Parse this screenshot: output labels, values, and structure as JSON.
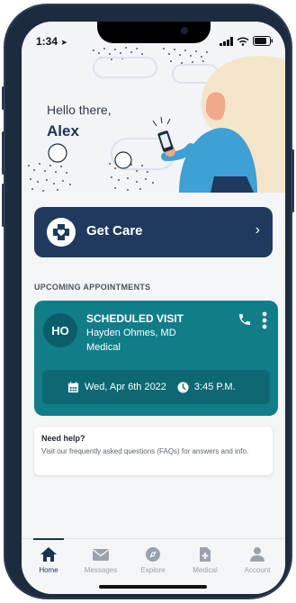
{
  "status": {
    "time": "1:34"
  },
  "hero": {
    "greeting": "Hello there,",
    "name": "Alex"
  },
  "get_care": {
    "label": "Get Care",
    "chevron": "›"
  },
  "section_title": "UPCOMING APPOINTMENTS",
  "appointment": {
    "initials": "HO",
    "title": "SCHEDULED VISIT",
    "doctor": "Hayden Ohmes, MD",
    "specialty": "Medical",
    "date": "Wed, Apr 6th 2022",
    "time": "3:45 P.M."
  },
  "help": {
    "title": "Need help?",
    "text": "Visit our frequently asked questions (FAQs) for answers and info."
  },
  "tabs": [
    {
      "label": "Home",
      "icon": "home-icon"
    },
    {
      "label": "Messages",
      "icon": "mail-icon"
    },
    {
      "label": "Explore",
      "icon": "compass-icon"
    },
    {
      "label": "Medical",
      "icon": "medical-file-icon"
    },
    {
      "label": "Account",
      "icon": "person-icon"
    }
  ],
  "colors": {
    "navy": "#1f3a5f",
    "teal": "#117d89",
    "teal_dark": "#0d6874",
    "tab_active": "#1c3356",
    "tab_inactive": "#9aa3ad"
  }
}
